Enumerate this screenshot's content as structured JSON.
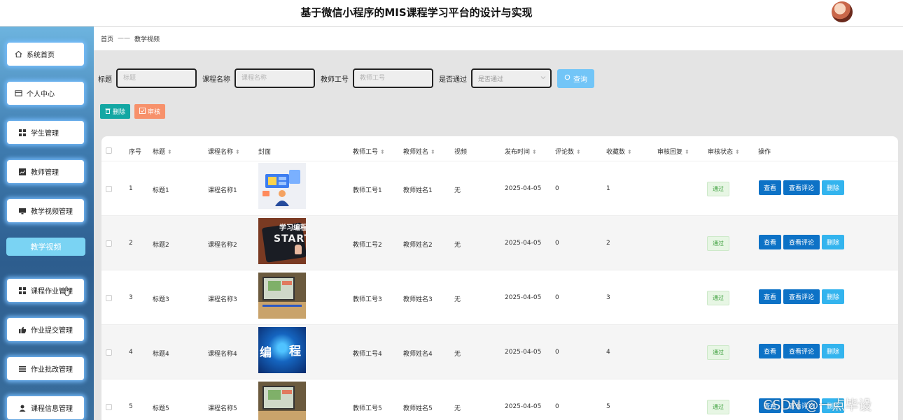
{
  "header": {
    "title": "基于微信小程序的MIS课程学习平台的设计与实现"
  },
  "sidebar": {
    "items": [
      {
        "label": "系统首页",
        "icon": "home-icon"
      },
      {
        "label": "个人中心",
        "icon": "card-icon"
      },
      {
        "label": "学生管理",
        "icon": "grid-icon"
      },
      {
        "label": "教师管理",
        "icon": "chart-icon"
      },
      {
        "label": "教学视频管理",
        "icon": "monitor-icon"
      },
      {
        "label": "课程作业管理",
        "icon": "grid-icon"
      },
      {
        "label": "作业提交管理",
        "icon": "thumb-icon"
      },
      {
        "label": "作业批改管理",
        "icon": "list-icon"
      },
      {
        "label": "课程信息管理",
        "icon": "user-icon"
      }
    ],
    "active_sub": "教学视频"
  },
  "breadcrumb": {
    "home": "首页",
    "separator": "——",
    "current": "教学视频"
  },
  "search": {
    "title_label": "标题",
    "title_placeholder": "标题",
    "course_label": "课程名称",
    "course_placeholder": "课程名称",
    "teacher_label": "教师工号",
    "teacher_placeholder": "教师工号",
    "pass_label": "是否通过",
    "pass_placeholder": "是否通过",
    "query_button": "查询"
  },
  "actions": {
    "delete": "删除",
    "audit": "审核"
  },
  "table": {
    "headers": {
      "index": "序号",
      "title": "标题",
      "course": "课程名称",
      "cover": "封面",
      "teacher_id": "教师工号",
      "teacher_name": "教师姓名",
      "video": "视频",
      "publish_time": "发布时间",
      "comments": "评论数",
      "favorites": "收藏数",
      "reply": "审核回复",
      "status": "审核状态",
      "ops": "操作"
    },
    "rows": [
      {
        "index": "1",
        "title": "标题1",
        "course": "课程名称1",
        "teacher_id": "教师工号1",
        "teacher_name": "教师姓名1",
        "video": "无",
        "publish_time": "2025-04-05",
        "comments": "0",
        "favorites": "1",
        "status": "通过"
      },
      {
        "index": "2",
        "title": "标题2",
        "course": "课程名称2",
        "teacher_id": "教师工号2",
        "teacher_name": "教师姓名2",
        "video": "无",
        "publish_time": "2025-04-05",
        "comments": "0",
        "favorites": "2",
        "status": "通过"
      },
      {
        "index": "3",
        "title": "标题3",
        "course": "课程名称3",
        "teacher_id": "教师工号3",
        "teacher_name": "教师姓名3",
        "video": "无",
        "publish_time": "2025-04-05",
        "comments": "0",
        "favorites": "3",
        "status": "通过"
      },
      {
        "index": "4",
        "title": "标题4",
        "course": "课程名称4",
        "teacher_id": "教师工号4",
        "teacher_name": "教师姓名4",
        "video": "无",
        "publish_time": "2025-04-05",
        "comments": "0",
        "favorites": "4",
        "status": "通过"
      },
      {
        "index": "5",
        "title": "标题5",
        "course": "课程名称5",
        "teacher_id": "教师工号5",
        "teacher_name": "教师姓名5",
        "video": "无",
        "publish_time": "2025-04-05",
        "comments": "0",
        "favorites": "5",
        "status": "通过"
      }
    ],
    "op_view": "查看",
    "op_comments": "查看评论",
    "op_delete": "删除"
  },
  "covers": {
    "row2_text_top": "学习编程",
    "row2_text_bottom": "START",
    "row4_text_left": "编",
    "row4_text_right": "程"
  },
  "watermark": "CSDN @一点毕设",
  "colors": {
    "primary": "#0d72c6",
    "teal": "#13a7a3",
    "orange": "#f7916b",
    "light_blue": "#72c5f7"
  }
}
